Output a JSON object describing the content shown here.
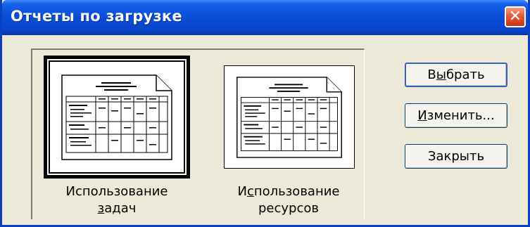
{
  "window": {
    "title": "Отчеты по загрузке",
    "close_symbol": "✕"
  },
  "reports": [
    {
      "label_line1": "Использование",
      "label_line2_u": "з",
      "label_line2_rest": "адач",
      "selected": true
    },
    {
      "label_line1_pre": "И",
      "label_line1_u": "с",
      "label_line1_rest": "пользование",
      "label_line2": "ресурсов",
      "selected": false
    }
  ],
  "buttons": {
    "select": {
      "pre": "В",
      "u": "ы",
      "rest": "брать"
    },
    "edit": {
      "u": "И",
      "rest": "зменить..."
    },
    "close": {
      "label": "Закрыть"
    }
  },
  "colors": {
    "titlebar": "#0a4fd9",
    "dialog_bg": "#ece9d8",
    "close_btn": "#e2502a"
  }
}
